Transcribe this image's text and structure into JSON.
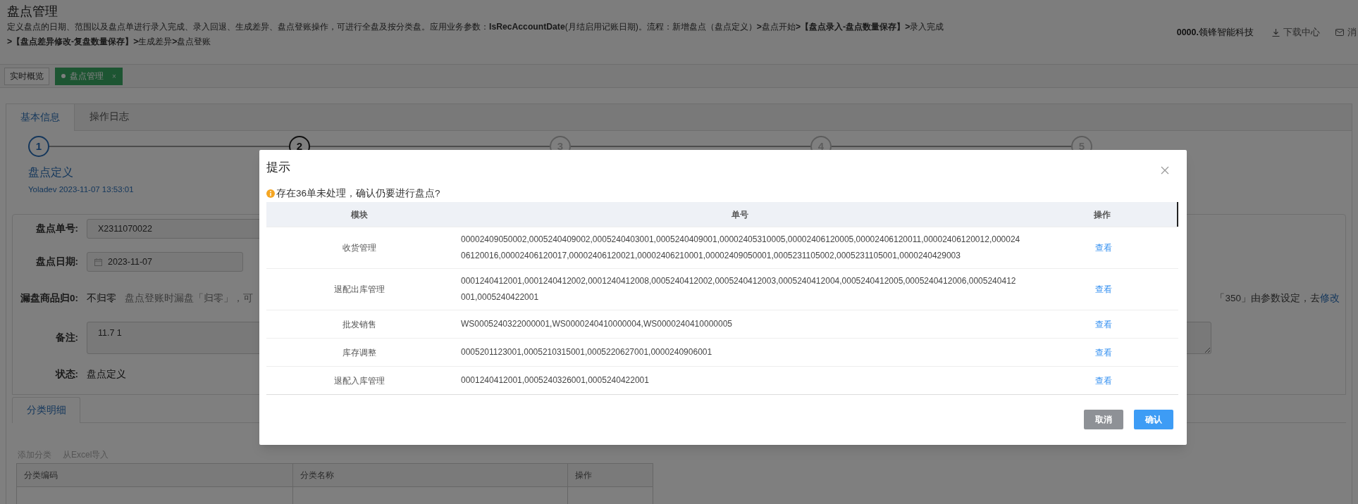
{
  "page_title": "盘点管理",
  "description": "定义盘点的日期、范围以及盘点单进行录入完成、录入回退、生成差异、盘点登账操作，可进行全盘及按分类盘。应用业务参数：**IsRecAccountDate**(月结启用记账日期)。流程：新增盘点（盘点定义）**>**盘点开始**>【盘点录入-盘点数量保存】>**录入完成**>【盘点差异修改-复盘数量保存】>**生成差异**>**盘点登账",
  "header_right": {
    "company": "**0000.**领锋智能科技",
    "links": [
      {
        "kind": "download",
        "label": "下载中心"
      },
      {
        "kind": "mail",
        "label": "消"
      }
    ]
  },
  "page_tabs": [
    {
      "label": "实时概览",
      "selected": false
    },
    {
      "label": "盘点管理",
      "selected": true,
      "close": "×"
    }
  ],
  "main_tabs": [
    {
      "label": "基本信息",
      "selected": true
    },
    {
      "label": "操作日志",
      "selected": false
    }
  ],
  "steps": [
    {
      "number": "1",
      "current": true,
      "next": false,
      "title": "盘点定义",
      "subtitle": "Yoladev 2023-11-07 13:53:01"
    },
    {
      "number": "2",
      "current": false,
      "next": true
    },
    {
      "number": "3",
      "current": false,
      "next": false
    },
    {
      "number": "4",
      "current": false,
      "next": false
    },
    {
      "number": "5",
      "current": false,
      "next": false
    }
  ],
  "form": {
    "fields": [
      {
        "kind": "input",
        "label": "盘点单号:",
        "value": "X2311070022"
      },
      {
        "kind": "date",
        "label": "盘点日期:",
        "value": "2023-11-07"
      },
      {
        "kind": "text",
        "label": "漏盘商品归0:",
        "value": "不归零",
        "hint_start": "盘点登账时漏盘「归零」，可",
        "hint_end": "「350」由参数设定，去",
        "link": "修改"
      },
      {
        "kind": "textarea",
        "label": "备注:",
        "value": "11.7 1"
      },
      {
        "kind": "text",
        "label": "状态:",
        "value": "盘点定义"
      }
    ]
  },
  "detail_tabs": [
    {
      "label": "分类明细",
      "selected": true
    }
  ],
  "toolbar": [
    "添加分类",
    "从Excel导入"
  ],
  "detail_table": {
    "columns": [
      "分类编码",
      "分类名称",
      "操作"
    ]
  },
  "dialog": {
    "title": "提示",
    "message": "存在36单未处理，确认仍要进行盘点?",
    "columns": [
      "模块",
      "单号",
      "操作"
    ],
    "rows": [
      {
        "module": "收货管理",
        "numbers": "00002409050002,0005240409002,0005240403001,0005240409001,00002405310005,00002406120005,00002406120011,00002406120012,00002406120016,00002406120017,00002406120021,00002406210001,00002409050001,0005231105002,0005231105001,0000240429003",
        "action": "查看"
      },
      {
        "module": "退配出库管理",
        "numbers": "0001240412001,0001240412002,0001240412008,0005240412002,0005240412003,0005240412004,0005240412005,0005240412006,0005240412001,0005240422001",
        "action": "查看"
      },
      {
        "module": "批发销售",
        "numbers": "WS0005240322000001,WS0000240410000004,WS0000240410000005",
        "action": "查看"
      },
      {
        "module": "库存调整",
        "numbers": "0005201123001,0005210315001,0005220627001,0000240906001",
        "action": "查看"
      },
      {
        "module": "退配入库管理",
        "numbers": "0001240412001,0005240326001,0005240422001",
        "action": "查看"
      }
    ],
    "buttons": [
      {
        "kind": "cancel",
        "label": "取消"
      },
      {
        "kind": "confirm",
        "label": "确认"
      }
    ]
  }
}
